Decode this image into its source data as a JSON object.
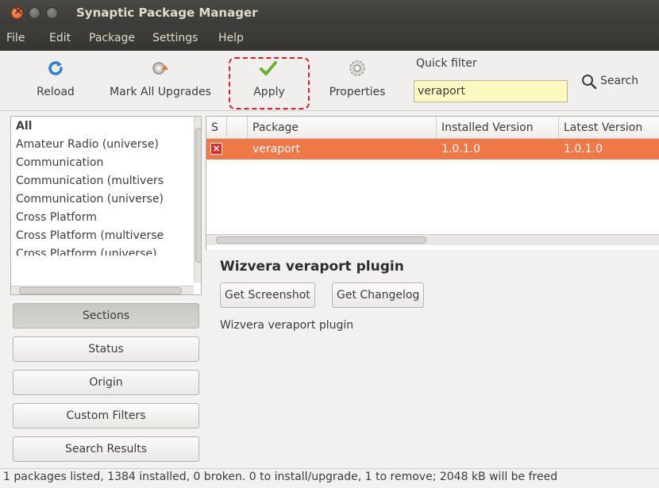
{
  "window": {
    "title": "Synaptic Package Manager"
  },
  "menubar": {
    "items": [
      "File",
      "Edit",
      "Package",
      "Settings",
      "Help"
    ]
  },
  "toolbar": {
    "reload_label": "Reload",
    "mark_all_label": "Mark All Upgrades",
    "apply_label": "Apply",
    "properties_label": "Properties",
    "quick_filter_label": "Quick filter",
    "quick_filter_value": "veraport",
    "search_label": "Search"
  },
  "sections": {
    "items": [
      "All",
      "Amateur Radio (universe)",
      "Communication",
      "Communication (multivers",
      "Communication (universe)",
      "Cross Platform",
      "Cross Platform (multiverse",
      "Cross Platform (universe)"
    ],
    "selected": "All"
  },
  "filter_buttons": [
    "Sections",
    "Status",
    "Origin",
    "Custom Filters",
    "Search Results"
  ],
  "active_filter": "Sections",
  "package_table": {
    "columns": [
      "S",
      "Package",
      "Installed Version",
      "Latest Version"
    ],
    "rows": [
      {
        "status": "remove",
        "package": "veraport",
        "installed": "1.0.1.0",
        "latest": "1.0.1.0"
      }
    ]
  },
  "details": {
    "title": "Wizvera veraport plugin",
    "screenshot_btn": "Get Screenshot",
    "changelog_btn": "Get Changelog",
    "description": "Wizvera veraport plugin"
  },
  "statusbar": {
    "text": "1 packages listed, 1384 installed, 0 broken. 0 to install/upgrade, 1 to remove; 2048 kB will be freed"
  },
  "colors": {
    "selection": "#f07746",
    "highlight_dash": "#e02020",
    "filter_bg": "#fbf8c0"
  }
}
